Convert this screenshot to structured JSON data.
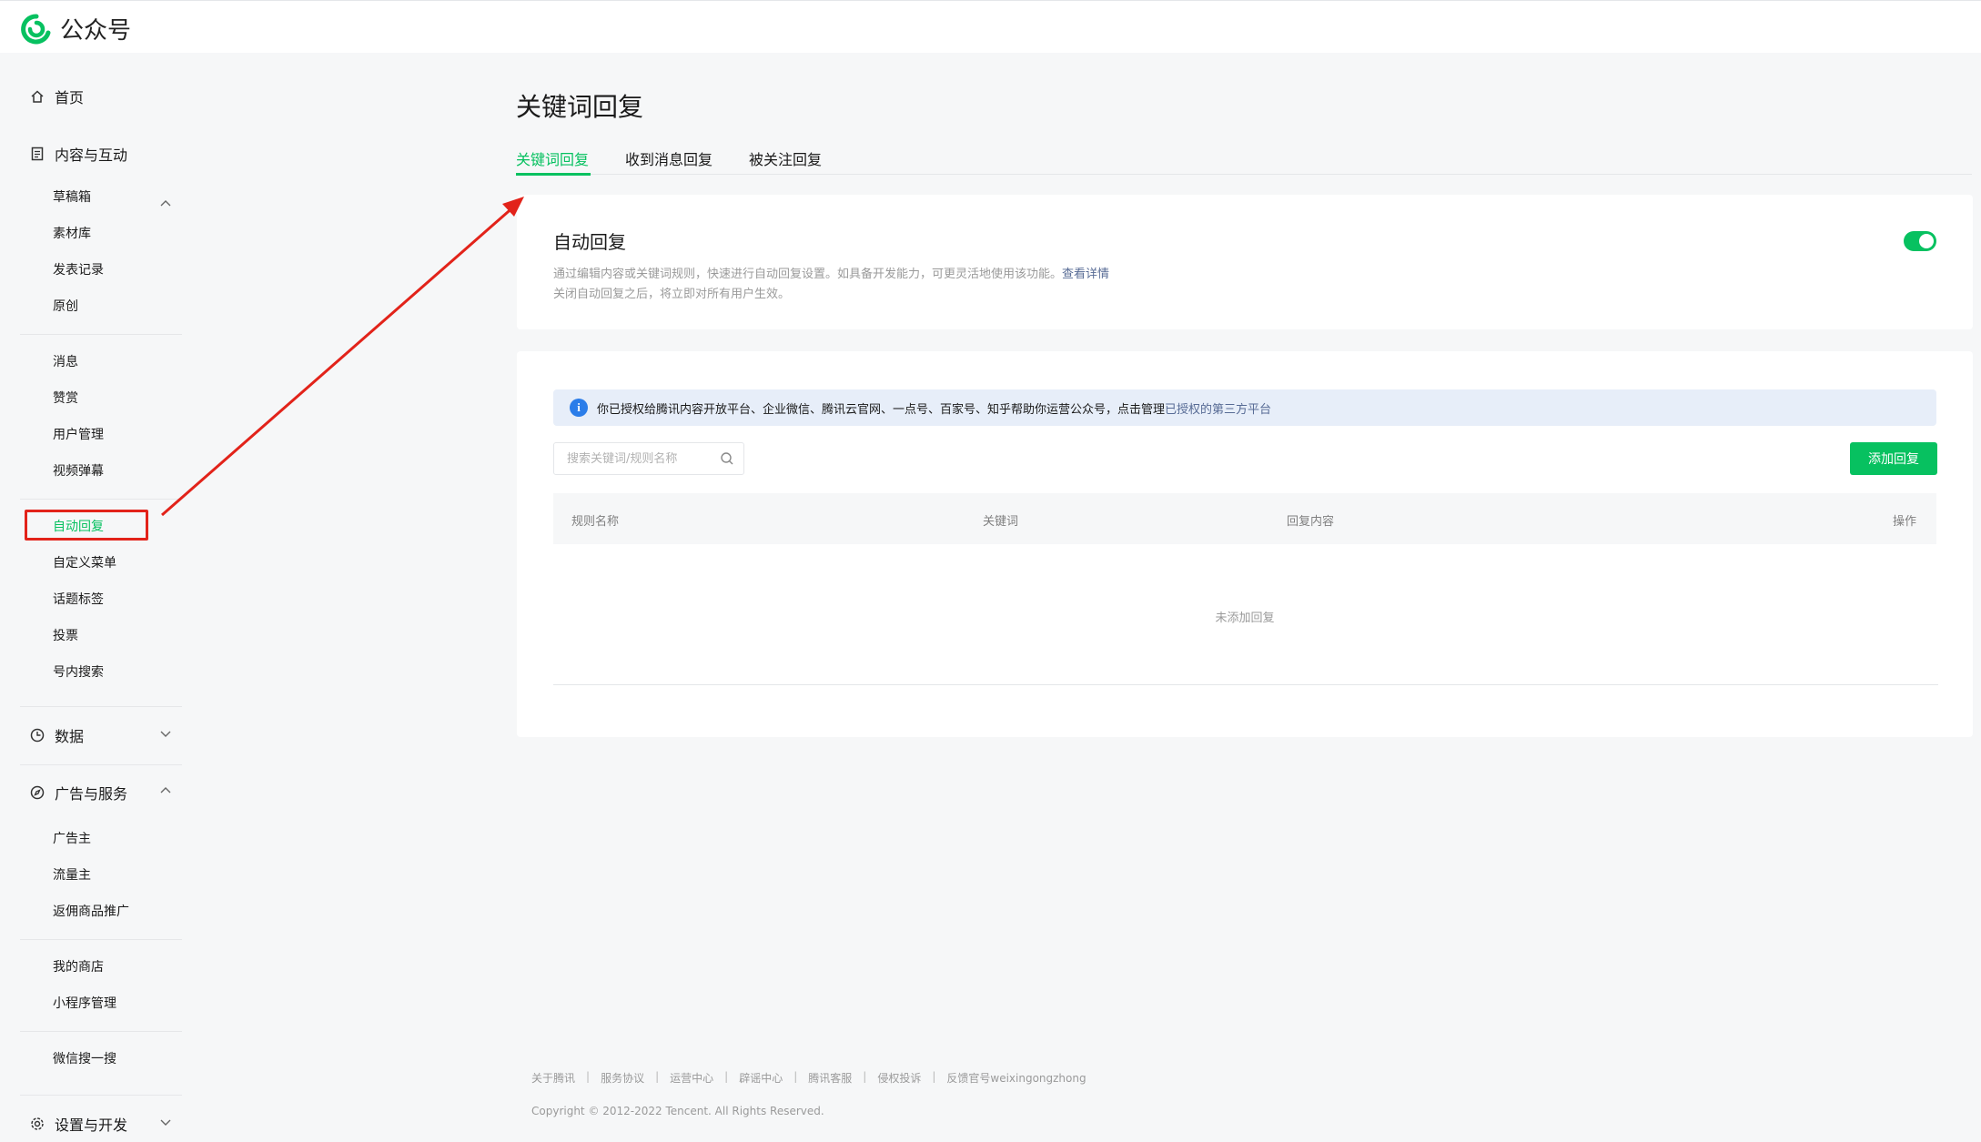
{
  "app": {
    "name": "公众号"
  },
  "sidebar": {
    "home": "首页",
    "content": {
      "label": "内容与互动",
      "items": [
        "草稿箱",
        "素材库",
        "发表记录",
        "原创"
      ],
      "items2": [
        "消息",
        "赞赏",
        "用户管理",
        "视频弹幕"
      ],
      "items3": [
        "自动回复",
        "自定义菜单",
        "话题标签",
        "投票",
        "号内搜索"
      ]
    },
    "data": {
      "label": "数据"
    },
    "ads": {
      "label": "广告与服务",
      "items": [
        "广告主",
        "流量主",
        "返佣商品推广"
      ],
      "items2": [
        "我的商店",
        "小程序管理"
      ],
      "items3": [
        "微信搜一搜"
      ]
    },
    "settings": {
      "label": "设置与开发"
    }
  },
  "main": {
    "title": "关键词回复",
    "tabs": [
      {
        "label": "关键词回复",
        "active": true
      },
      {
        "label": "收到消息回复",
        "active": false
      },
      {
        "label": "被关注回复",
        "active": false
      }
    ],
    "auto_reply": {
      "title": "自动回复",
      "desc": "通过编辑内容或关键词规则，快速进行自动回复设置。如具备开发能力，可更灵活地使用该功能。",
      "link": "查看详情",
      "desc2": "关闭自动回复之后，将立即对所有用户生效。",
      "enabled": true
    },
    "notice": {
      "text": "你已授权给腾讯内容开放平台、企业微信、腾讯云官网、一点号、百家号、知乎帮助你运营公众号，点击管理",
      "link": "已授权的第三方平台"
    },
    "search": {
      "placeholder": "搜索关键词/规则名称"
    },
    "add_button": "添加回复",
    "table": {
      "columns": [
        "规则名称",
        "关键词",
        "回复内容",
        "操作"
      ],
      "empty": "未添加回复"
    }
  },
  "footer": {
    "links": [
      "关于腾讯",
      "服务协议",
      "运营中心",
      "辟谣中心",
      "腾讯客服",
      "侵权投诉",
      "反馈官号weixingongzhong"
    ],
    "copyright": "Copyright © 2012-2022 Tencent. All Rights Reserved."
  },
  "colors": {
    "accent": "#07c160",
    "link": "#576b95",
    "annotation": "#e2231a"
  }
}
